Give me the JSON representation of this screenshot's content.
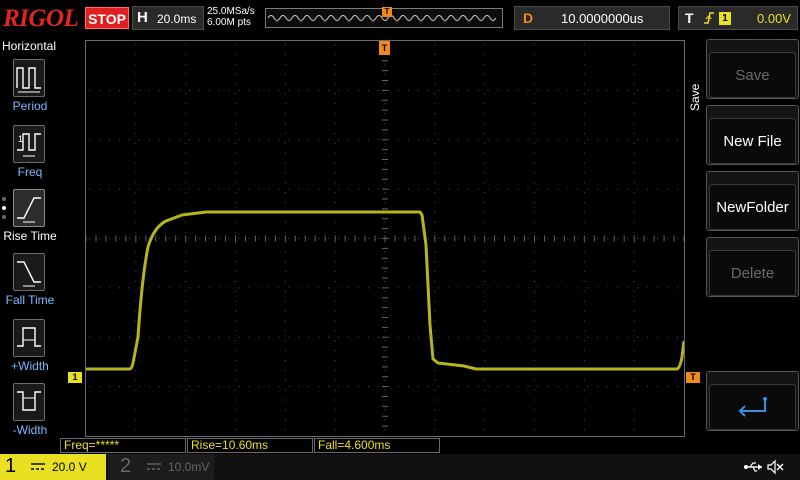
{
  "topbar": {
    "logo": "RIGOL",
    "run_status": "STOP",
    "h_letter": "H",
    "h_scale": "20.0ms",
    "sample_rate": "25.0MSa/s",
    "mem_depth": "6.00M pts",
    "trig_pos_glyph": "T",
    "d_letter": "D",
    "delay": "10.0000000us",
    "t_letter": "T",
    "trig_edge_icon": "rising-edge-icon",
    "trig_source": "1",
    "trig_level": "0.00V"
  },
  "left_menu": {
    "title": "Horizontal",
    "items": [
      {
        "label": "Period",
        "icon": "period-icon"
      },
      {
        "label": "Freq",
        "icon": "freq-icon"
      },
      {
        "label": "Rise Time",
        "icon": "rise-time-icon"
      },
      {
        "label": "Fall Time",
        "icon": "fall-time-icon"
      },
      {
        "label": "+Width",
        "icon": "positive-width-icon"
      },
      {
        "label": "-Width",
        "icon": "negative-width-icon"
      }
    ]
  },
  "right_menu": {
    "title": "Save",
    "buttons": [
      {
        "label": "Save",
        "enabled": false
      },
      {
        "label": "New File",
        "enabled": true
      },
      {
        "label": "NewFolder",
        "enabled": true
      },
      {
        "label": "Delete",
        "enabled": false
      },
      {
        "label": "",
        "icon": "return-arrow-icon",
        "enabled": true
      }
    ]
  },
  "measurements": {
    "freq": "Freq=*****",
    "rise": "Rise=10.60ms",
    "fall": "Fall=4.600ms"
  },
  "markers": {
    "ch1_offset": "1",
    "trig_level": "T",
    "trig_top": "T"
  },
  "channels": {
    "ch1": {
      "number": "1",
      "coupling": "DC",
      "scale": "20.0 V",
      "color": "#e8e020"
    },
    "ch2": {
      "number": "2",
      "coupling": "DC",
      "scale": "10.0mV",
      "color": "#666666"
    }
  },
  "colors": {
    "trace": "#b5b51e",
    "trigger": "#f08a18",
    "stop": "#e02020",
    "menu_label": "#7ab8ff"
  }
}
